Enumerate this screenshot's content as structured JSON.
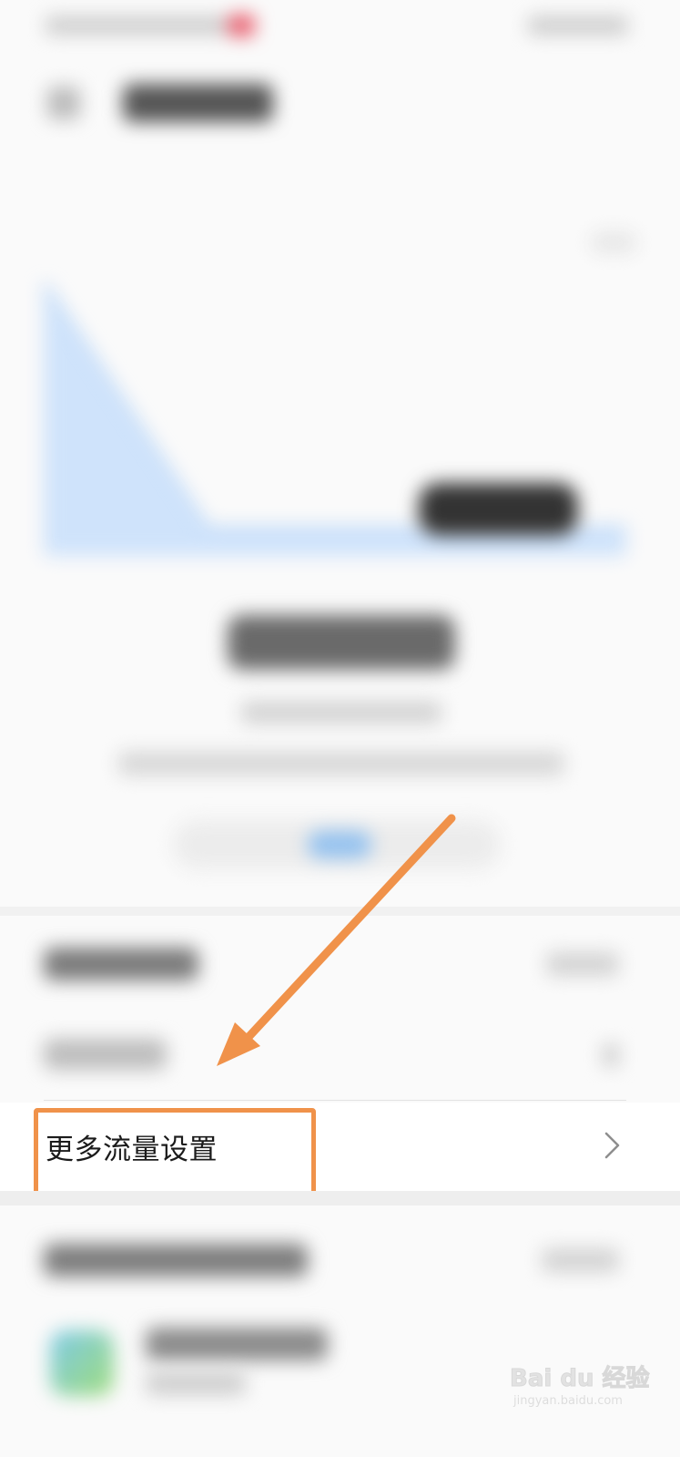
{
  "settings_row": {
    "label": "更多流量设置"
  },
  "watermark": {
    "logo_text": "Bai du 经验",
    "domain": "jingyan.baidu.com"
  },
  "colors": {
    "annotation_orange": "#f0924a",
    "chart_fill": "#cfe3fb",
    "accent_blue": "#93c1ef"
  },
  "icons": {
    "settings_row_chevron": "chevron-right-icon",
    "back": "back-arrow-icon"
  }
}
